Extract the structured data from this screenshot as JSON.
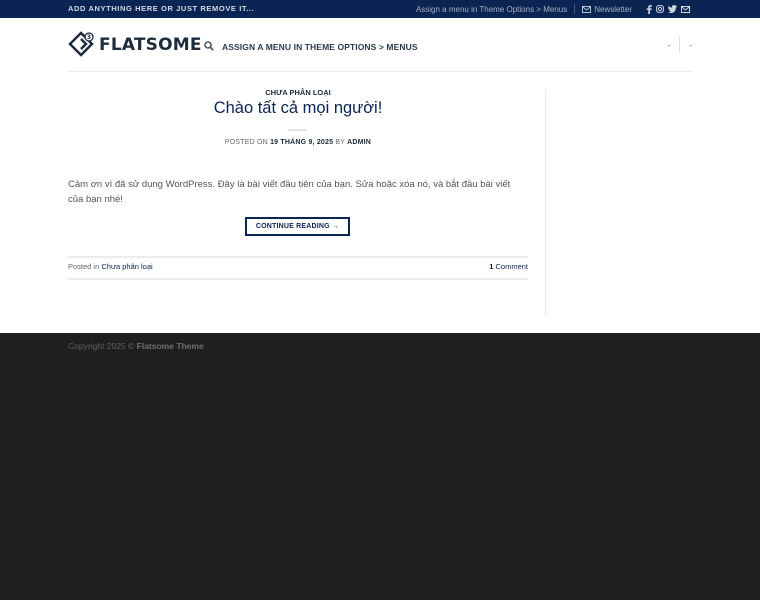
{
  "topbar": {
    "left_text": "ADD ANYTHING HERE OR JUST REMOVE IT...",
    "menu_link": "Assign a menu in Theme Options > Menus",
    "newsletter": "Newsletter",
    "icons": [
      "facebook-icon",
      "instagram-icon",
      "twitter-icon",
      "email-icon"
    ],
    "bg_color": "#0a2453"
  },
  "header": {
    "logo_text": "FLATSOME",
    "nav_label": "ASSIGN A MENU IN THEME OPTIONS > MENUS",
    "right_item_1": "-",
    "right_item_2": "-"
  },
  "post": {
    "category": "CHƯA PHÂN LOẠI",
    "title": "Chào tất cả mọi người!",
    "meta_prefix": "POSTED ON ",
    "meta_date": "19 THÁNG 9, 2025",
    "meta_by": " BY ",
    "meta_author": "ADMIN",
    "excerpt": "Cảm ơn vì đã sử dụng WordPress. Đây là bài viết đầu tiên của bạn. Sửa hoặc xóa nó, và bắt đầu bài viết của bạn nhé!",
    "continue_label": "CONTINUE READING →",
    "posted_in_prefix": "Posted in ",
    "posted_in_category": "Chưa phân loại",
    "comments_count": "1",
    "comments_label": " Comment"
  },
  "footer": {
    "copyright_prefix": "Copyright 2025 © ",
    "copyright_brand": "Flatsome Theme",
    "bg_color": "#1f1f1f"
  }
}
